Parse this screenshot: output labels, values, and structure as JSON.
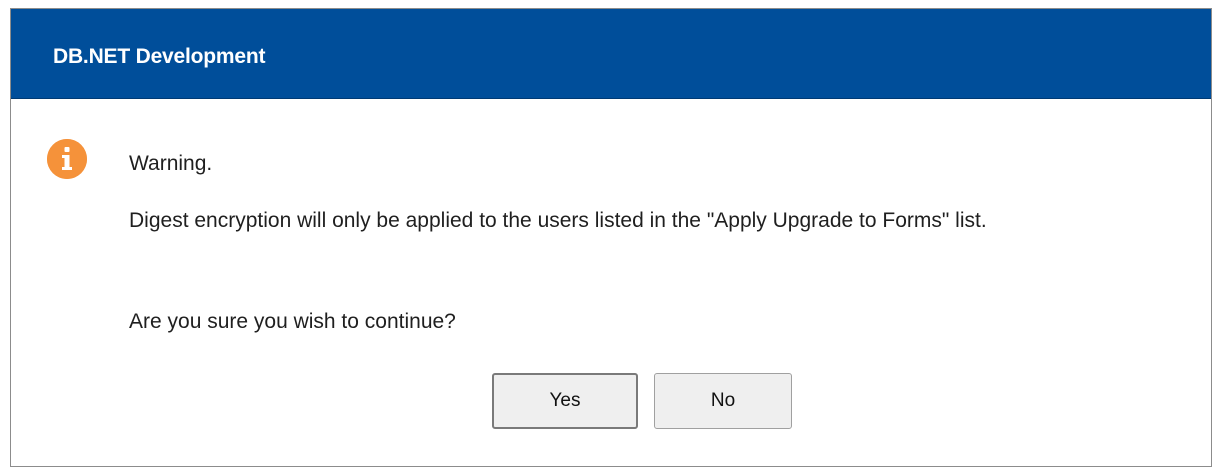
{
  "dialog": {
    "title": "DB.NET Development",
    "icon": "warning-info-icon",
    "accent_color": "#004e9a",
    "icon_color": "#f5923a",
    "warning_label": "Warning.",
    "message": "Digest encryption will only be applied to the users listed in the \"Apply Upgrade to Forms\" list.",
    "question": "Are you sure you wish to continue?",
    "buttons": {
      "yes_label": "Yes",
      "no_label": "No"
    }
  }
}
